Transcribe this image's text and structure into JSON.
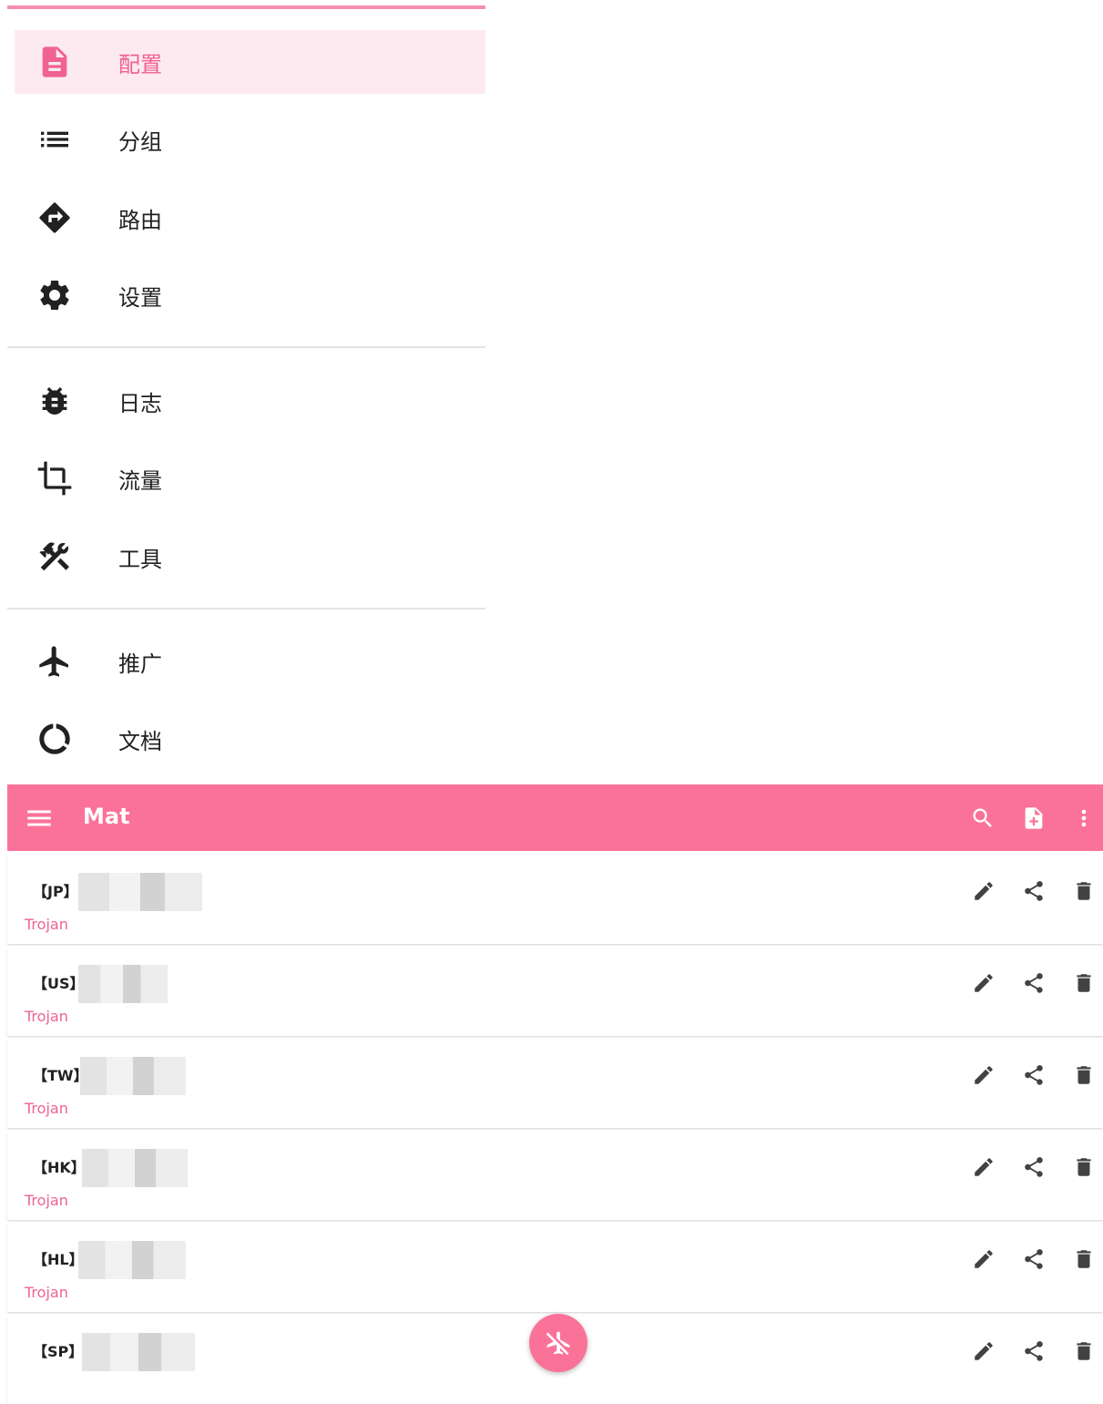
{
  "drawer": {
    "items": [
      {
        "label": "配置",
        "icon": "file-document-icon",
        "active": true
      },
      {
        "label": "分组",
        "icon": "list-icon"
      },
      {
        "label": "路由",
        "icon": "directions-icon"
      },
      {
        "label": "设置",
        "icon": "gear-icon"
      },
      {
        "label": "日志",
        "icon": "bug-icon"
      },
      {
        "label": "流量",
        "icon": "crop-icon"
      },
      {
        "label": "工具",
        "icon": "tools-icon"
      },
      {
        "label": "推广",
        "icon": "airplane-icon"
      },
      {
        "label": "文档",
        "icon": "circle-notch-icon"
      }
    ]
  },
  "appbar": {
    "title": "Mat",
    "actions": [
      "search-icon",
      "file-add-icon",
      "more-vert-icon"
    ]
  },
  "profiles": [
    {
      "tag": "【JP】",
      "type": "Trojan"
    },
    {
      "tag": "【US】",
      "type": "Trojan"
    },
    {
      "tag": "【TW】",
      "type": "Trojan"
    },
    {
      "tag": "【HK】",
      "type": "Trojan"
    },
    {
      "tag": "【HL】",
      "type": "Trojan"
    },
    {
      "tag": "【SP】",
      "type": "Trojan"
    }
  ],
  "colors": {
    "accent": "#fb7299",
    "active_bg": "#fdeaf1",
    "link": "#f06292"
  }
}
